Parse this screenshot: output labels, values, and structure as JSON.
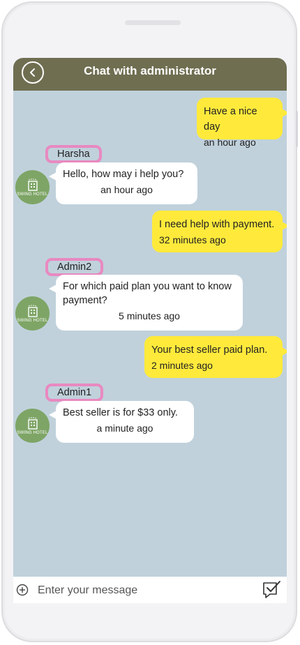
{
  "header": {
    "title": "Chat with administrator",
    "back_icon": "chevron-left-icon"
  },
  "messages": [
    {
      "direction": "out",
      "text": "Have a nice day",
      "time": "an hour ago"
    },
    {
      "direction": "in",
      "sender": "Harsha",
      "text": "Hello, how may i help you?",
      "time": "an hour ago",
      "avatar": "SWING HOTEL"
    },
    {
      "direction": "out",
      "text": "I need help with payment.",
      "time": "32 minutes ago"
    },
    {
      "direction": "in",
      "sender": "Admin2",
      "text": "For which paid plan you want to know payment?",
      "time": "5 minutes ago",
      "avatar": "SWING HOTEL"
    },
    {
      "direction": "out",
      "text": "Your best seller paid plan.",
      "time": "2 minutes ago"
    },
    {
      "direction": "in",
      "sender": "Admin1",
      "text": "Best seller is for $33 only.",
      "time": "a minute ago",
      "avatar": "SWING HOTEL"
    }
  ],
  "composer": {
    "placeholder": "Enter your message",
    "add_icon": "plus-circle-icon",
    "send_icon": "send-check-icon"
  },
  "colors": {
    "header": "#6f6e51",
    "chat_background": "#c0d1db",
    "outgoing_bubble": "#ffea3b",
    "incoming_bubble": "#ffffff",
    "name_tag_border": "#e889c1",
    "avatar": "#7ea566"
  }
}
